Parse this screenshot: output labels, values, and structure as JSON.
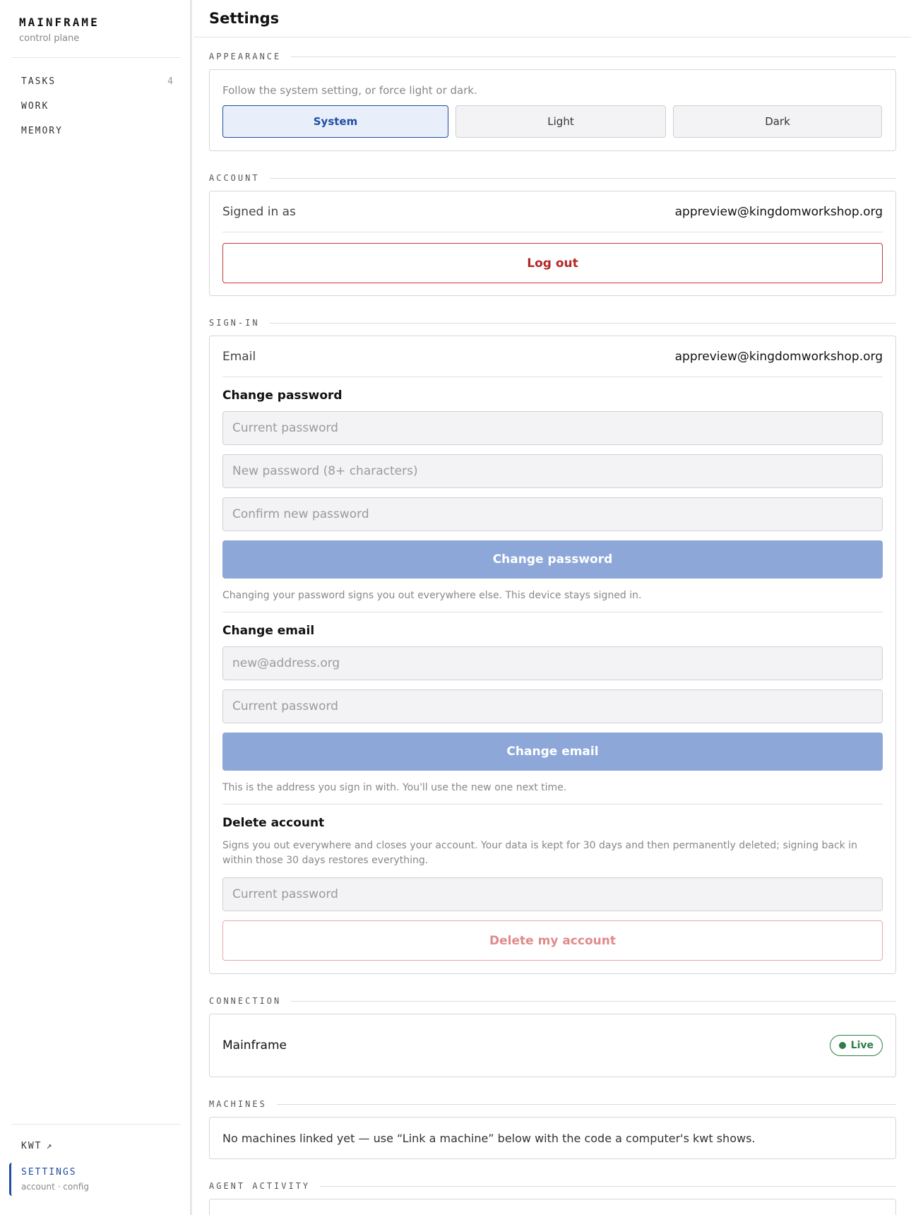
{
  "brand": {
    "title": "MAINFRAME",
    "subtitle": "control plane"
  },
  "nav": {
    "items": [
      {
        "label": "TASKS",
        "count": "4"
      },
      {
        "label": "WORK",
        "count": ""
      },
      {
        "label": "MEMORY",
        "count": ""
      }
    ],
    "kwt": {
      "label": "KWT",
      "arrow": "↗"
    },
    "settings": {
      "label": "SETTINGS",
      "sub": "account · config"
    }
  },
  "header": {
    "title": "Settings"
  },
  "appearance": {
    "heading": "APPEARANCE",
    "description": "Follow the system setting, or force light or dark.",
    "options": [
      "System",
      "Light",
      "Dark"
    ],
    "selected": "System"
  },
  "account": {
    "heading": "ACCOUNT",
    "signed_in_label": "Signed in as",
    "signed_in_value": "appreview@kingdomworkshop.org",
    "logout_label": "Log out"
  },
  "signin": {
    "heading": "SIGN-IN",
    "email_label": "Email",
    "email_value": "appreview@kingdomworkshop.org",
    "change_password": {
      "title": "Change password",
      "current_placeholder": "Current password",
      "new_placeholder": "New password (8+ characters)",
      "confirm_placeholder": "Confirm new password",
      "button": "Change password",
      "help": "Changing your password signs you out everywhere else. This device stays signed in."
    },
    "change_email": {
      "title": "Change email",
      "new_placeholder": "new@address.org",
      "current_placeholder": "Current password",
      "button": "Change email",
      "help": "This is the address you sign in with. You'll use the new one next time."
    },
    "delete_account": {
      "title": "Delete account",
      "help": "Signs you out everywhere and closes your account. Your data is kept for 30 days and then permanently deleted; signing back in within those 30 days restores everything.",
      "current_placeholder": "Current password",
      "button": "Delete my account"
    }
  },
  "connection": {
    "heading": "CONNECTION",
    "name": "Mainframe",
    "status": "Live",
    "status_color": "#2f7d4a"
  },
  "machines": {
    "heading": "MACHINES",
    "empty_text": "No machines linked yet — use “Link a machine” below with the code a computer's kwt shows."
  },
  "agent_activity": {
    "heading": "AGENT ACTIVITY"
  },
  "colors": {
    "accent": "#1f4ea3",
    "danger": "#b52727",
    "primary_disabled": "#8da7d9"
  }
}
